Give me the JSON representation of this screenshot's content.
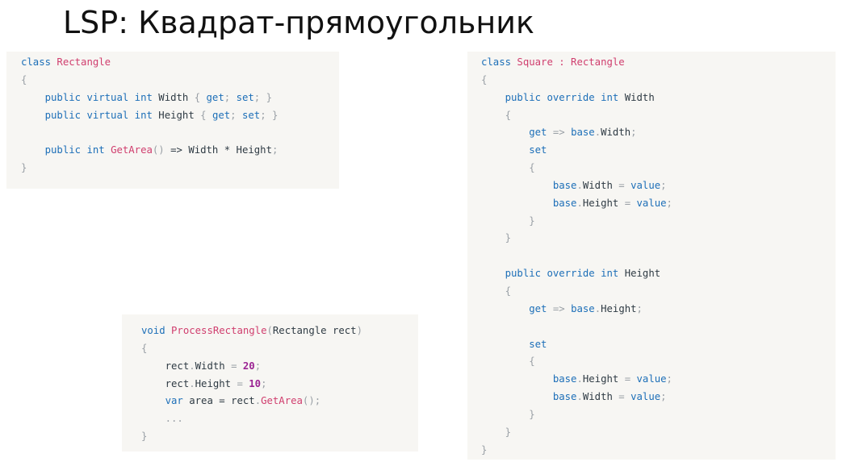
{
  "title": "LSP: Квадрат-прямоугольник",
  "code_blocks": [
    {
      "id": "rectangle-class",
      "lines": [
        [
          [
            "kw",
            "class "
          ],
          [
            "cls",
            "Rectangle"
          ]
        ],
        [
          [
            "pun",
            "{"
          ]
        ],
        [
          [
            "id",
            "    "
          ],
          [
            "kw",
            "public virtual int "
          ],
          [
            "id",
            "Width "
          ],
          [
            "pun",
            "{ "
          ],
          [
            "kw",
            "get"
          ],
          [
            "pun",
            "; "
          ],
          [
            "kw",
            "set"
          ],
          [
            "pun",
            "; }"
          ]
        ],
        [
          [
            "id",
            "    "
          ],
          [
            "kw",
            "public virtual int "
          ],
          [
            "id",
            "Height "
          ],
          [
            "pun",
            "{ "
          ],
          [
            "kw",
            "get"
          ],
          [
            "pun",
            "; "
          ],
          [
            "kw",
            "set"
          ],
          [
            "pun",
            "; }"
          ]
        ],
        [],
        [
          [
            "id",
            "    "
          ],
          [
            "kw",
            "public int "
          ],
          [
            "cls",
            "GetArea"
          ],
          [
            "pun",
            "() "
          ],
          [
            "id",
            "=> Width * Height"
          ],
          [
            "pun",
            ";"
          ]
        ],
        [
          [
            "pun",
            "}"
          ]
        ]
      ]
    },
    {
      "id": "process-rectangle",
      "lines": [
        [
          [
            "kw",
            "void "
          ],
          [
            "cls",
            "ProcessRectangle"
          ],
          [
            "pun",
            "("
          ],
          [
            "id",
            "Rectangle rect"
          ],
          [
            "pun",
            ")"
          ]
        ],
        [
          [
            "pun",
            "{"
          ]
        ],
        [
          [
            "id",
            "    rect"
          ],
          [
            "pun",
            "."
          ],
          [
            "id",
            "Width "
          ],
          [
            "pun",
            "= "
          ],
          [
            "num",
            "20"
          ],
          [
            "pun",
            ";"
          ]
        ],
        [
          [
            "id",
            "    rect"
          ],
          [
            "pun",
            "."
          ],
          [
            "id",
            "Height "
          ],
          [
            "pun",
            "= "
          ],
          [
            "num",
            "10"
          ],
          [
            "pun",
            ";"
          ]
        ],
        [
          [
            "id",
            "    "
          ],
          [
            "kw",
            "var "
          ],
          [
            "id",
            "area = rect"
          ],
          [
            "pun",
            "."
          ],
          [
            "cls",
            "GetArea"
          ],
          [
            "pun",
            "();"
          ]
        ],
        [
          [
            "pun",
            "    ..."
          ]
        ],
        [
          [
            "pun",
            "}"
          ]
        ]
      ]
    },
    {
      "id": "square-class",
      "lines": [
        [
          [
            "kw",
            "class "
          ],
          [
            "cls",
            "Square : Rectangle"
          ]
        ],
        [
          [
            "pun",
            "{"
          ]
        ],
        [
          [
            "id",
            "    "
          ],
          [
            "kw",
            "public override int "
          ],
          [
            "id",
            "Width"
          ]
        ],
        [
          [
            "pun",
            "    {"
          ]
        ],
        [
          [
            "id",
            "        "
          ],
          [
            "kw",
            "get "
          ],
          [
            "pun",
            "=> "
          ],
          [
            "kw",
            "base"
          ],
          [
            "pun",
            "."
          ],
          [
            "id",
            "Width"
          ],
          [
            "pun",
            ";"
          ]
        ],
        [
          [
            "id",
            "        "
          ],
          [
            "kw",
            "set"
          ]
        ],
        [
          [
            "pun",
            "        {"
          ]
        ],
        [
          [
            "id",
            "            "
          ],
          [
            "kw",
            "base"
          ],
          [
            "pun",
            "."
          ],
          [
            "id",
            "Width "
          ],
          [
            "pun",
            "= "
          ],
          [
            "kw",
            "value"
          ],
          [
            "pun",
            ";"
          ]
        ],
        [
          [
            "id",
            "            "
          ],
          [
            "kw",
            "base"
          ],
          [
            "pun",
            "."
          ],
          [
            "id",
            "Height "
          ],
          [
            "pun",
            "= "
          ],
          [
            "kw",
            "value"
          ],
          [
            "pun",
            ";"
          ]
        ],
        [
          [
            "pun",
            "        }"
          ]
        ],
        [
          [
            "pun",
            "    }"
          ]
        ],
        [],
        [
          [
            "id",
            "    "
          ],
          [
            "kw",
            "public override int "
          ],
          [
            "id",
            "Height"
          ]
        ],
        [
          [
            "pun",
            "    {"
          ]
        ],
        [
          [
            "id",
            "        "
          ],
          [
            "kw",
            "get "
          ],
          [
            "pun",
            "=> "
          ],
          [
            "kw",
            "base"
          ],
          [
            "pun",
            "."
          ],
          [
            "id",
            "Height"
          ],
          [
            "pun",
            ";"
          ]
        ],
        [],
        [
          [
            "id",
            "        "
          ],
          [
            "kw",
            "set"
          ]
        ],
        [
          [
            "pun",
            "        {"
          ]
        ],
        [
          [
            "id",
            "            "
          ],
          [
            "kw",
            "base"
          ],
          [
            "pun",
            "."
          ],
          [
            "id",
            "Height "
          ],
          [
            "pun",
            "= "
          ],
          [
            "kw",
            "value"
          ],
          [
            "pun",
            ";"
          ]
        ],
        [
          [
            "id",
            "            "
          ],
          [
            "kw",
            "base"
          ],
          [
            "pun",
            "."
          ],
          [
            "id",
            "Width "
          ],
          [
            "pun",
            "= "
          ],
          [
            "kw",
            "value"
          ],
          [
            "pun",
            ";"
          ]
        ],
        [
          [
            "pun",
            "        }"
          ]
        ],
        [
          [
            "pun",
            "    }"
          ]
        ],
        [
          [
            "pun",
            "}"
          ]
        ]
      ]
    }
  ]
}
